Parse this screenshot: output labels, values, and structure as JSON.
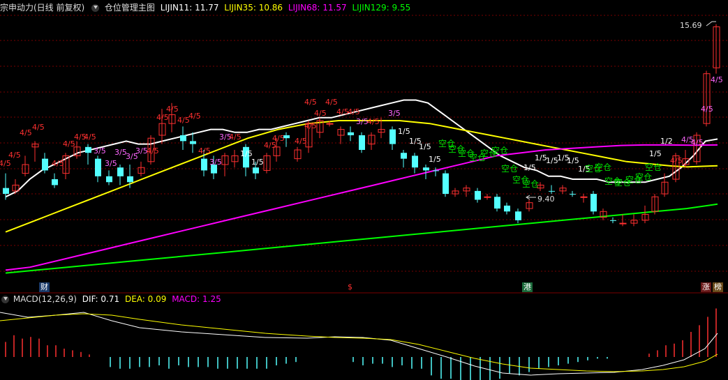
{
  "header": {
    "stock_title": "宗申动力(日线 前复权)",
    "indicator_name": "仓位管理主图",
    "lines": [
      {
        "label": "LIJIN11: 11.77",
        "color": "#ffffff"
      },
      {
        "label": "LIJIN35: 10.86",
        "color": "#ffff00"
      },
      {
        "label": "LIJIN68: 11.57",
        "color": "#ff00ff"
      },
      {
        "label": "LIJIN129: 9.55",
        "color": "#00ff00"
      }
    ]
  },
  "macd_header": {
    "name": "MACD(12,26,9)",
    "dif": "DIF: 0.71",
    "dea": "DEA: 0.09",
    "macd": "MACD: 1.25"
  },
  "bottom_markers": {
    "cai": "财",
    "dollar": "$",
    "gang": "港",
    "zhang": "涨",
    "bang": "榜"
  },
  "annotations": {
    "high_label": "15.69",
    "low_label": "9.40"
  },
  "signal_texts": {
    "four_fifths": "4/5",
    "three_fifths": "3/5",
    "one_fifth": "1/5",
    "one_half": "1/2",
    "kongcang": "空仓"
  },
  "colors": {
    "up": "#ff3030",
    "down": "#54ffff",
    "ma11": "#ffffff",
    "ma35": "#ffff00",
    "ma68": "#ff00ff",
    "ma129": "#00ff00",
    "grid": "#7a0000"
  },
  "chart_data": [
    {
      "type": "candlestick",
      "title": "宗申动力(日线 前复权)",
      "series": [
        {
          "name": "LIJIN11",
          "values": [
            9.8,
            10.0,
            10.4,
            10.7,
            10.9,
            11.1,
            11.3,
            11.4,
            11.5,
            11.6,
            11.7,
            11.6,
            11.6,
            11.7,
            11.8,
            11.9,
            12.0,
            12.1,
            12.1,
            12.0,
            12.0,
            12.1,
            12.1,
            12.2,
            12.3,
            12.4,
            12.5,
            12.5,
            12.6,
            12.7,
            12.8,
            12.9,
            13.0,
            13.1,
            13.1,
            13.0,
            12.7,
            12.4,
            12.1,
            11.8,
            11.5,
            11.2,
            11.0,
            10.8,
            10.7,
            10.5,
            10.5,
            10.4,
            10.4,
            10.4,
            10.3,
            10.3,
            10.3,
            10.3,
            10.4,
            10.5,
            10.8,
            11.2,
            11.7,
            11.77
          ]
        },
        {
          "name": "LIJIN35",
          "values": [
            8.6,
            8.8,
            9.0,
            9.2,
            9.4,
            9.6,
            9.8,
            10.0,
            10.2,
            10.4,
            10.6,
            10.8,
            11.0,
            11.2,
            11.4,
            11.6,
            11.8,
            11.95,
            12.1,
            12.2,
            12.3,
            12.35,
            12.4,
            12.4,
            12.4,
            12.4,
            12.4,
            12.35,
            12.3,
            12.2,
            12.1,
            12.0,
            11.9,
            11.8,
            11.7,
            11.6,
            11.5,
            11.4,
            11.3,
            11.2,
            11.1,
            11.0,
            10.95,
            10.9,
            10.85,
            10.82,
            10.84,
            10.86
          ]
        },
        {
          "name": "LIJIN68",
          "values": [
            7.3,
            7.4,
            7.6,
            7.8,
            8.0,
            8.2,
            8.4,
            8.6,
            8.8,
            9.0,
            9.2,
            9.4,
            9.6,
            9.8,
            10.0,
            10.2,
            10.4,
            10.6,
            10.8,
            11.0,
            11.2,
            11.3,
            11.4,
            11.45,
            11.5,
            11.55,
            11.57,
            11.57,
            11.56,
            11.57
          ]
        },
        {
          "name": "LIJIN129",
          "values": [
            7.2,
            7.3,
            7.4,
            7.5,
            7.6,
            7.7,
            7.8,
            7.9,
            8.0,
            8.1,
            8.2,
            8.3,
            8.4,
            8.5,
            8.6,
            8.7,
            8.8,
            8.9,
            9.0,
            9.1,
            9.2,
            9.3,
            9.4,
            9.55
          ]
        }
      ],
      "annotations": {
        "high": 15.69,
        "low": 9.4
      },
      "ylim": [
        7.0,
        16.0
      ]
    },
    {
      "type": "bar",
      "title": "MACD(12,26,9)",
      "series": [
        {
          "name": "DIF",
          "value": 0.71
        },
        {
          "name": "DEA",
          "value": 0.09
        },
        {
          "name": "MACD",
          "value": 1.25
        }
      ]
    }
  ]
}
